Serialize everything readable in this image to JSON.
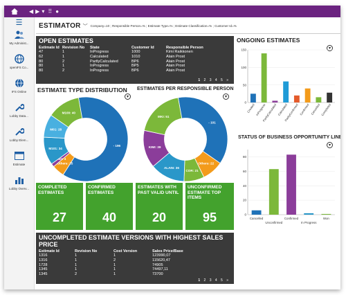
{
  "app": {
    "title": "ESTIMATOR",
    "filters": "Company=10 ; Responsible Person=% ; Estimate Type=% ; Estimate Classification=% ; Customer Id=%"
  },
  "sidebar": {
    "items": [
      {
        "label": "My Administ...",
        "icon": "people-icon"
      },
      {
        "label": "openIFS Co...",
        "icon": "globe-icon"
      },
      {
        "label": "IFS Online",
        "icon": "globe-icon"
      },
      {
        "label": "Lobby Data...",
        "icon": "wrench-icon"
      },
      {
        "label": "Lobby Elem...",
        "icon": "wrench-icon"
      },
      {
        "label": "Estimate",
        "icon": "window-icon"
      },
      {
        "label": "Lobby Overv...",
        "icon": "bar-chart-icon"
      }
    ]
  },
  "open_estimates": {
    "title": "OPEN ESTIMATES",
    "columns": [
      "Estimate Id",
      "Revision No",
      "State",
      "Customer Id",
      "Responsible Person"
    ],
    "rows": [
      [
        "47",
        "1",
        "InProgress",
        "1000",
        "Kimi Raikkonen"
      ],
      [
        "62",
        "1",
        "Calculated",
        "1010",
        "Alain Prost"
      ],
      [
        "80",
        "2",
        "PartlyCalculated",
        "BP6",
        "Alain Prost"
      ],
      [
        "80",
        "1",
        "InProgress",
        "BP5",
        "Alain Prost"
      ],
      [
        "80",
        "2",
        "InProgress",
        "BP6",
        "Alain Prost"
      ]
    ],
    "pages": [
      "1",
      "2",
      "3",
      "4",
      "5",
      "»"
    ]
  },
  "estimate_type_distribution": {
    "title": "ESTIMATE TYPE DISTRIBUTION",
    "chart_data": {
      "type": "pie",
      "slices": [
        {
          "label": "- 196",
          "value": 196,
          "color": "#1f72b8"
        },
        {
          "label": "Others: 15",
          "value": 15,
          "color": "#f39b1b"
        },
        {
          "label": "M50: 4",
          "value": 4,
          "color": "#8b3d9a"
        },
        {
          "label": "M101: 34",
          "value": 34,
          "color": "#2a97c9"
        },
        {
          "label": "M01: 28",
          "value": 28,
          "color": "#49b0e0"
        },
        {
          "label": "M100: 40",
          "value": 40,
          "color": "#7cb83a"
        }
      ]
    }
  },
  "estimates_per_person": {
    "title": "ESTIMATES PER RESPONSIBLE PERSON",
    "chart_data": {
      "type": "pie",
      "slices": [
        {
          "label": "- 101",
          "value": 101,
          "color": "#1f72b8"
        },
        {
          "label": "Others: 22",
          "value": 22,
          "color": "#f39b1b"
        },
        {
          "label": "COR: 21",
          "value": 21,
          "color": "#7cb83a"
        },
        {
          "label": "ALAIN: 36",
          "value": 36,
          "color": "#2a97c9"
        },
        {
          "label": "KIMI: 39",
          "value": 39,
          "color": "#8b3d9a"
        },
        {
          "label": "MKI: 51",
          "value": 51,
          "color": "#7cb83a"
        }
      ]
    }
  },
  "kpis": [
    {
      "label": "COMPLETED ESTIMATES",
      "value": "27"
    },
    {
      "label": "CONFIRMED ESTIMATES",
      "value": "40"
    },
    {
      "label": "ESTIMATES WITH PAST VALID UNTIL",
      "value": "20"
    },
    {
      "label": "UNCONFIRMED ESTIMATE TOP ITEMS",
      "value": "95"
    }
  ],
  "uncompleted_versions": {
    "title": "UNCOMPLETED ESTIMATE VERSIONS WITH HIGHEST SALES PRICE",
    "columns": [
      "Estimate Id",
      "Revision No",
      "Cost Version",
      "Sales Price/Base"
    ],
    "rows": [
      [
        "1316",
        "1",
        "1",
        "123990,07"
      ],
      [
        "1316",
        "1",
        "2",
        "115620,47"
      ],
      [
        "1728",
        "1",
        "1",
        "74905"
      ],
      [
        "1345",
        "1",
        "1",
        "74497,11"
      ],
      [
        "1345",
        "2",
        "1",
        "73700"
      ]
    ],
    "pages": [
      "1",
      "2",
      "3",
      "4",
      "5",
      "»"
    ]
  },
  "ongoing_estimates": {
    "title": "ONGOING ESTIMATES",
    "chart_data": {
      "type": "bar",
      "categories": [
        "Created",
        "InProgress",
        "PartlyCalculated",
        "Calculated",
        "PartlyConfirmed",
        "Confirmed",
        "Cancelled",
        "Completed"
      ],
      "values": [
        25,
        140,
        5,
        60,
        20,
        40,
        15,
        28
      ],
      "colors": [
        "#1f72b8",
        "#7cb83a",
        "#8b3d9a",
        "#1f9bd7",
        "#e45b2b",
        "#f39b1b",
        "#7cb83a",
        "#333333"
      ],
      "yticks": [
        "0",
        "50",
        "100",
        "150"
      ],
      "ylim": [
        0,
        150
      ]
    }
  },
  "status_opportunity": {
    "title": "STATUS OF BUSINESS OPPORTUNITY LINES",
    "chart_data": {
      "type": "bar",
      "categories": [
        "Cancelled",
        "Unconfirmed",
        "Confirmed",
        "In Progress",
        "Won"
      ],
      "values": [
        6,
        63,
        83,
        2,
        1
      ],
      "colors": [
        "#1f72b8",
        "#7cb83a",
        "#8b3d9a",
        "#2a97c9",
        "#7cb83a"
      ],
      "yticks": [
        "0",
        "20",
        "40",
        "60",
        "80"
      ],
      "ylim": [
        0,
        90
      ]
    }
  }
}
